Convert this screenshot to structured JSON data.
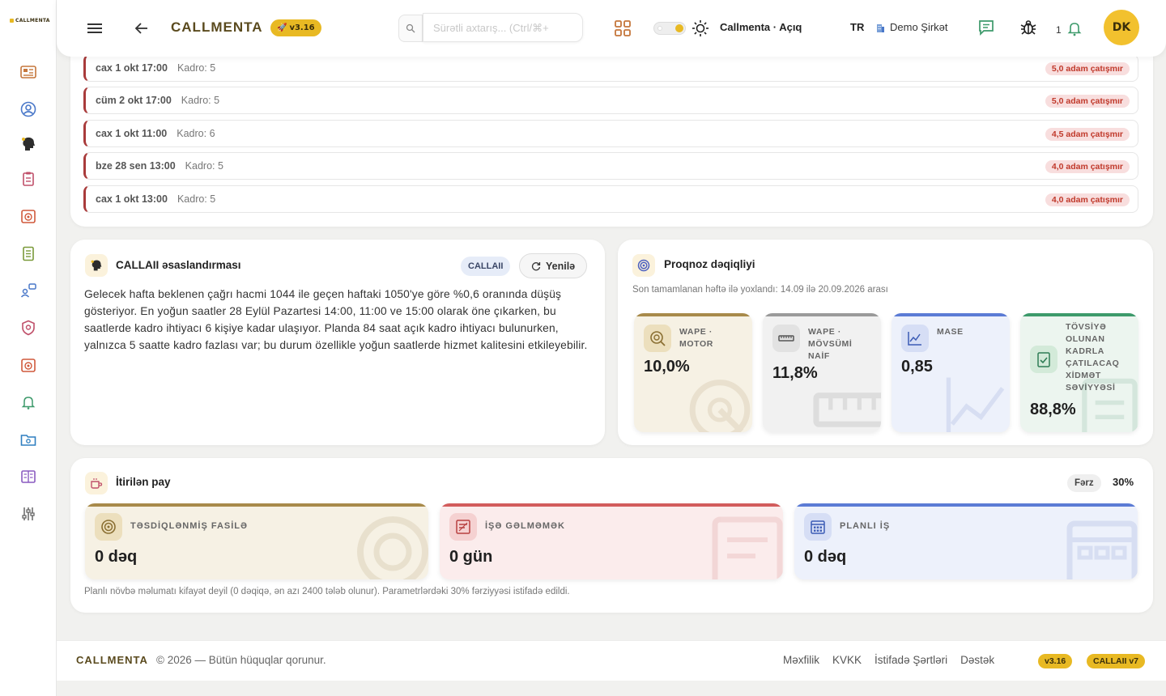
{
  "sidebar": {
    "logo_text": "CALLMENTA"
  },
  "header": {
    "brand": "CALLMENTA",
    "version": "v3.16",
    "search_placeholder": "Sürətli axtarış... (Ctrl/⌘+",
    "theme_label": "Callmenta · Açıq",
    "language": "TR",
    "company": "Demo Şirkət",
    "notification_count": "1",
    "avatar_initials": "DK"
  },
  "shortages": [
    {
      "when": "cax 1 okt 17:00",
      "kadro": "Kadro: 5",
      "status": "5,0 adam çatışmır"
    },
    {
      "when": "cüm 2 okt 17:00",
      "kadro": "Kadro: 5",
      "status": "5,0 adam çatışmır"
    },
    {
      "when": "cax 1 okt 11:00",
      "kadro": "Kadro: 6",
      "status": "4,5 adam çatışmır"
    },
    {
      "when": "bze 28 sen 13:00",
      "kadro": "Kadro: 5",
      "status": "4,0 adam çatışmır"
    },
    {
      "when": "cax 1 okt 13:00",
      "kadro": "Kadro: 5",
      "status": "4,0 adam çatışmır"
    }
  ],
  "ai": {
    "title": "CALLAII əsaslandırması",
    "tag": "CALLAII",
    "refresh_label": "Yenilə",
    "text": "Gelecek hafta beklenen çağrı hacmi 1044 ile geçen haftaki 1050'ye göre %0,6 oranında düşüş gösteriyor. En yoğun saatler 28 Eylül Pazartesi 14:00, 11:00 ve 15:00 olarak öne çıkarken, bu saatlerde kadro ihtiyacı 6 kişiye kadar ulaşıyor. Planda 84 saat açık kadro ihtiyacı bulunurken, yalnızca 5 saatte kadro fazlası var; bu durum özellikle yoğun saatlerde hizmet kalitesini etkileyebilir."
  },
  "forecast": {
    "title": "Proqnoz dəqiqliyi",
    "subtitle": "Son tamamlanan həftə ilə yoxlandı: 14.09 ilə 20.09.2026 arası",
    "metrics": [
      {
        "label": "WAPE · MOTOR",
        "value": "10,0%",
        "color": "#a88a4a"
      },
      {
        "label": "WAPE · MÖVSÜMİ NAİF",
        "value": "11,8%",
        "color": "#9a9a9a"
      },
      {
        "label": "MASE",
        "value": "0,85",
        "color": "#5b7bd5"
      },
      {
        "label": "TÖVSİYƏ OLUNAN KADRLA ÇATILACAQ XİDMƏT SƏVİYYƏSİ",
        "value": "88,8%",
        "color": "#3d9a6b"
      }
    ]
  },
  "lost": {
    "title": "İtirilən pay",
    "assume_label": "Fərz",
    "assume_value": "30%",
    "cards": [
      {
        "label": "TƏSDİQLƏNMİŞ FASİLƏ",
        "value": "0 dəq",
        "color": "#a88a4a"
      },
      {
        "label": "İŞƏ GƏLMƏMƏK",
        "value": "0 gün",
        "color": "#d25c5c"
      },
      {
        "label": "PLANLI İŞ",
        "value": "0 dəq",
        "color": "#5b7bd5"
      }
    ],
    "note": "Planlı növbə məlumatı kifayət deyil (0 dəqiqə, ən azı 2400 tələb olunur). Parametrlərdəki 30% fərziyyəsi istifadə edildi."
  },
  "footer": {
    "brand": "CALLMENTA",
    "copyright": "© 2026 — Bütün hüquqlar qorunur.",
    "links": [
      "Məxfilik",
      "KVKK",
      "İstifadə Şərtləri",
      "Dəstək"
    ],
    "badge_version": "v3.16",
    "badge_ai": "CALLAII v7"
  }
}
